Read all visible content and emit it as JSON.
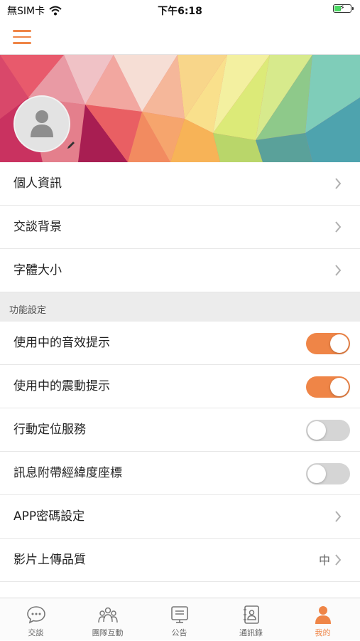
{
  "status_bar": {
    "carrier": "無SIM卡",
    "time": "下午6:18"
  },
  "menu": {
    "rows": [
      {
        "label": "個人資訊"
      },
      {
        "label": "交談背景"
      },
      {
        "label": "字體大小"
      }
    ]
  },
  "features": {
    "header": "功能設定",
    "toggles": [
      {
        "label": "使用中的音效提示",
        "on": true
      },
      {
        "label": "使用中的震動提示",
        "on": true
      },
      {
        "label": "行動定位服務",
        "on": false
      },
      {
        "label": "訊息附帶經緯度座標",
        "on": false
      }
    ],
    "app_password": "APP密碼設定",
    "video_quality": {
      "label": "影片上傳品質",
      "value": "中"
    }
  },
  "tabs": [
    {
      "label": "交談",
      "icon": "chat-bubble-icon"
    },
    {
      "label": "團隊互動",
      "icon": "team-icon"
    },
    {
      "label": "公告",
      "icon": "announcement-icon"
    },
    {
      "label": "通訊錄",
      "icon": "contacts-icon"
    },
    {
      "label": "我的",
      "icon": "profile-icon",
      "active": true
    }
  ],
  "colors": {
    "accent": "#ef8547",
    "toggle_off": "#d5d5d5",
    "section_bg": "#ececec"
  }
}
